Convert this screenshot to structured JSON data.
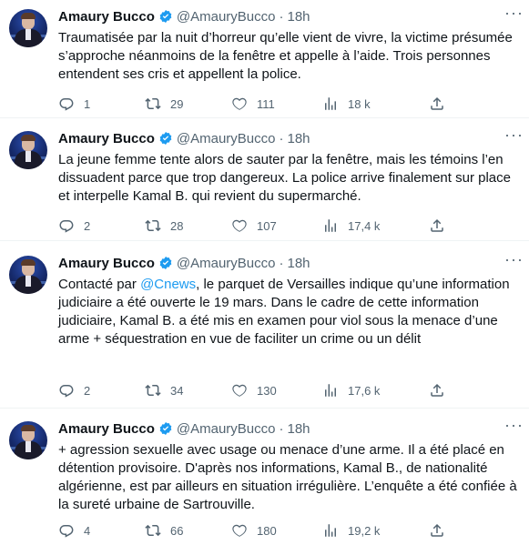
{
  "tweets": [
    {
      "author": "Amaury Bucco",
      "handle": "@AmauryBucco",
      "time": "18h",
      "text": "Traumatisée par la nuit d’horreur qu’elle vient de vivre, la victime présumée s’approche néanmoins de la fenêtre et appelle à l’aide. Trois personnes entendent ses cris et appellent la police.",
      "replies": "1",
      "retweets": "29",
      "likes": "111",
      "views": "18 k"
    },
    {
      "author": "Amaury Bucco",
      "handle": "@AmauryBucco",
      "time": "18h",
      "text": "La jeune femme tente alors de sauter par la fenêtre, mais les témoins l’en dissuadent parce que trop dangereux. La police arrive finalement sur place et interpelle Kamal B. qui revient du supermarché.",
      "replies": "2",
      "retweets": "28",
      "likes": "107",
      "views": "17,4 k"
    },
    {
      "author": "Amaury Bucco",
      "handle": "@AmauryBucco",
      "time": "18h",
      "text_prefix": "Contacté par ",
      "mention": "@Cnews",
      "text_suffix": ", le parquet de Versailles indique qu’une information judiciaire a été ouverte le 19 mars. Dans le cadre de cette information judiciaire, Kamal B. a été mis en examen pour viol sous la menace d’une arme + séquestration en vue de faciliter un crime ou un délit",
      "replies": "2",
      "retweets": "34",
      "likes": "130",
      "views": "17,6 k"
    },
    {
      "author": "Amaury Bucco",
      "handle": "@AmauryBucco",
      "time": "18h",
      "text": "+ agression sexuelle avec usage ou menace d’une arme. Il a été placé en détention provisoire. D'après nos informations, Kamal B., de nationalité algérienne, est par ailleurs en situation irrégulière. L’enquête a été confiée à la sureté urbaine de Sartrouville.",
      "replies": "4",
      "retweets": "66",
      "likes": "180",
      "views": "19,2 k"
    }
  ],
  "colors": {
    "text": "#0f1419",
    "muted": "#536471",
    "accent": "#1d9bf0",
    "divider": "#eff3f4"
  },
  "icons": [
    "verified-badge-icon",
    "more-options-icon",
    "reply-icon",
    "retweet-icon",
    "like-icon",
    "views-icon",
    "share-icon"
  ]
}
